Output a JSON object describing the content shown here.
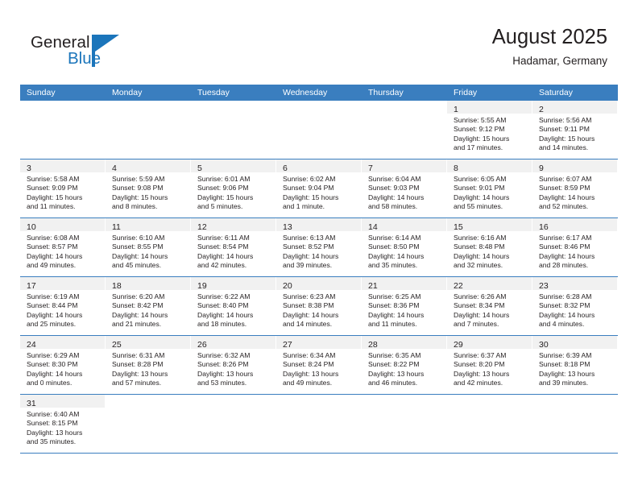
{
  "brand": {
    "name_part1": "General",
    "name_part2": "Blue",
    "triangle_color": "#1b75bb",
    "text_color": "#231f20"
  },
  "header": {
    "title": "August 2025",
    "subtitle": "Hadamar, Germany",
    "header_bg": "#3a7ebf",
    "header_text": "#ffffff"
  },
  "weekdays": [
    "Sunday",
    "Monday",
    "Tuesday",
    "Wednesday",
    "Thursday",
    "Friday",
    "Saturday"
  ],
  "labels": {
    "sunrise_prefix": "Sunrise:",
    "sunset_prefix": "Sunset:",
    "daylight_prefix": "Daylight:"
  },
  "weeks": [
    [
      {
        "day": "",
        "empty": true
      },
      {
        "day": "",
        "empty": true
      },
      {
        "day": "",
        "empty": true
      },
      {
        "day": "",
        "empty": true
      },
      {
        "day": "",
        "empty": true
      },
      {
        "day": "1",
        "sunrise": "Sunrise: 5:55 AM",
        "sunset": "Sunset: 9:12 PM",
        "daylight_line1": "Daylight: 15 hours",
        "daylight_line2": "and 17 minutes."
      },
      {
        "day": "2",
        "sunrise": "Sunrise: 5:56 AM",
        "sunset": "Sunset: 9:11 PM",
        "daylight_line1": "Daylight: 15 hours",
        "daylight_line2": "and 14 minutes."
      }
    ],
    [
      {
        "day": "3",
        "sunrise": "Sunrise: 5:58 AM",
        "sunset": "Sunset: 9:09 PM",
        "daylight_line1": "Daylight: 15 hours",
        "daylight_line2": "and 11 minutes."
      },
      {
        "day": "4",
        "sunrise": "Sunrise: 5:59 AM",
        "sunset": "Sunset: 9:08 PM",
        "daylight_line1": "Daylight: 15 hours",
        "daylight_line2": "and 8 minutes."
      },
      {
        "day": "5",
        "sunrise": "Sunrise: 6:01 AM",
        "sunset": "Sunset: 9:06 PM",
        "daylight_line1": "Daylight: 15 hours",
        "daylight_line2": "and 5 minutes."
      },
      {
        "day": "6",
        "sunrise": "Sunrise: 6:02 AM",
        "sunset": "Sunset: 9:04 PM",
        "daylight_line1": "Daylight: 15 hours",
        "daylight_line2": "and 1 minute."
      },
      {
        "day": "7",
        "sunrise": "Sunrise: 6:04 AM",
        "sunset": "Sunset: 9:03 PM",
        "daylight_line1": "Daylight: 14 hours",
        "daylight_line2": "and 58 minutes."
      },
      {
        "day": "8",
        "sunrise": "Sunrise: 6:05 AM",
        "sunset": "Sunset: 9:01 PM",
        "daylight_line1": "Daylight: 14 hours",
        "daylight_line2": "and 55 minutes."
      },
      {
        "day": "9",
        "sunrise": "Sunrise: 6:07 AM",
        "sunset": "Sunset: 8:59 PM",
        "daylight_line1": "Daylight: 14 hours",
        "daylight_line2": "and 52 minutes."
      }
    ],
    [
      {
        "day": "10",
        "sunrise": "Sunrise: 6:08 AM",
        "sunset": "Sunset: 8:57 PM",
        "daylight_line1": "Daylight: 14 hours",
        "daylight_line2": "and 49 minutes."
      },
      {
        "day": "11",
        "sunrise": "Sunrise: 6:10 AM",
        "sunset": "Sunset: 8:55 PM",
        "daylight_line1": "Daylight: 14 hours",
        "daylight_line2": "and 45 minutes."
      },
      {
        "day": "12",
        "sunrise": "Sunrise: 6:11 AM",
        "sunset": "Sunset: 8:54 PM",
        "daylight_line1": "Daylight: 14 hours",
        "daylight_line2": "and 42 minutes."
      },
      {
        "day": "13",
        "sunrise": "Sunrise: 6:13 AM",
        "sunset": "Sunset: 8:52 PM",
        "daylight_line1": "Daylight: 14 hours",
        "daylight_line2": "and 39 minutes."
      },
      {
        "day": "14",
        "sunrise": "Sunrise: 6:14 AM",
        "sunset": "Sunset: 8:50 PM",
        "daylight_line1": "Daylight: 14 hours",
        "daylight_line2": "and 35 minutes."
      },
      {
        "day": "15",
        "sunrise": "Sunrise: 6:16 AM",
        "sunset": "Sunset: 8:48 PM",
        "daylight_line1": "Daylight: 14 hours",
        "daylight_line2": "and 32 minutes."
      },
      {
        "day": "16",
        "sunrise": "Sunrise: 6:17 AM",
        "sunset": "Sunset: 8:46 PM",
        "daylight_line1": "Daylight: 14 hours",
        "daylight_line2": "and 28 minutes."
      }
    ],
    [
      {
        "day": "17",
        "sunrise": "Sunrise: 6:19 AM",
        "sunset": "Sunset: 8:44 PM",
        "daylight_line1": "Daylight: 14 hours",
        "daylight_line2": "and 25 minutes."
      },
      {
        "day": "18",
        "sunrise": "Sunrise: 6:20 AM",
        "sunset": "Sunset: 8:42 PM",
        "daylight_line1": "Daylight: 14 hours",
        "daylight_line2": "and 21 minutes."
      },
      {
        "day": "19",
        "sunrise": "Sunrise: 6:22 AM",
        "sunset": "Sunset: 8:40 PM",
        "daylight_line1": "Daylight: 14 hours",
        "daylight_line2": "and 18 minutes."
      },
      {
        "day": "20",
        "sunrise": "Sunrise: 6:23 AM",
        "sunset": "Sunset: 8:38 PM",
        "daylight_line1": "Daylight: 14 hours",
        "daylight_line2": "and 14 minutes."
      },
      {
        "day": "21",
        "sunrise": "Sunrise: 6:25 AM",
        "sunset": "Sunset: 8:36 PM",
        "daylight_line1": "Daylight: 14 hours",
        "daylight_line2": "and 11 minutes."
      },
      {
        "day": "22",
        "sunrise": "Sunrise: 6:26 AM",
        "sunset": "Sunset: 8:34 PM",
        "daylight_line1": "Daylight: 14 hours",
        "daylight_line2": "and 7 minutes."
      },
      {
        "day": "23",
        "sunrise": "Sunrise: 6:28 AM",
        "sunset": "Sunset: 8:32 PM",
        "daylight_line1": "Daylight: 14 hours",
        "daylight_line2": "and 4 minutes."
      }
    ],
    [
      {
        "day": "24",
        "sunrise": "Sunrise: 6:29 AM",
        "sunset": "Sunset: 8:30 PM",
        "daylight_line1": "Daylight: 14 hours",
        "daylight_line2": "and 0 minutes."
      },
      {
        "day": "25",
        "sunrise": "Sunrise: 6:31 AM",
        "sunset": "Sunset: 8:28 PM",
        "daylight_line1": "Daylight: 13 hours",
        "daylight_line2": "and 57 minutes."
      },
      {
        "day": "26",
        "sunrise": "Sunrise: 6:32 AM",
        "sunset": "Sunset: 8:26 PM",
        "daylight_line1": "Daylight: 13 hours",
        "daylight_line2": "and 53 minutes."
      },
      {
        "day": "27",
        "sunrise": "Sunrise: 6:34 AM",
        "sunset": "Sunset: 8:24 PM",
        "daylight_line1": "Daylight: 13 hours",
        "daylight_line2": "and 49 minutes."
      },
      {
        "day": "28",
        "sunrise": "Sunrise: 6:35 AM",
        "sunset": "Sunset: 8:22 PM",
        "daylight_line1": "Daylight: 13 hours",
        "daylight_line2": "and 46 minutes."
      },
      {
        "day": "29",
        "sunrise": "Sunrise: 6:37 AM",
        "sunset": "Sunset: 8:20 PM",
        "daylight_line1": "Daylight: 13 hours",
        "daylight_line2": "and 42 minutes."
      },
      {
        "day": "30",
        "sunrise": "Sunrise: 6:39 AM",
        "sunset": "Sunset: 8:18 PM",
        "daylight_line1": "Daylight: 13 hours",
        "daylight_line2": "and 39 minutes."
      }
    ],
    [
      {
        "day": "31",
        "sunrise": "Sunrise: 6:40 AM",
        "sunset": "Sunset: 8:15 PM",
        "daylight_line1": "Daylight: 13 hours",
        "daylight_line2": "and 35 minutes."
      },
      {
        "day": "",
        "empty": true
      },
      {
        "day": "",
        "empty": true
      },
      {
        "day": "",
        "empty": true
      },
      {
        "day": "",
        "empty": true
      },
      {
        "day": "",
        "empty": true
      },
      {
        "day": "",
        "empty": true
      }
    ]
  ]
}
